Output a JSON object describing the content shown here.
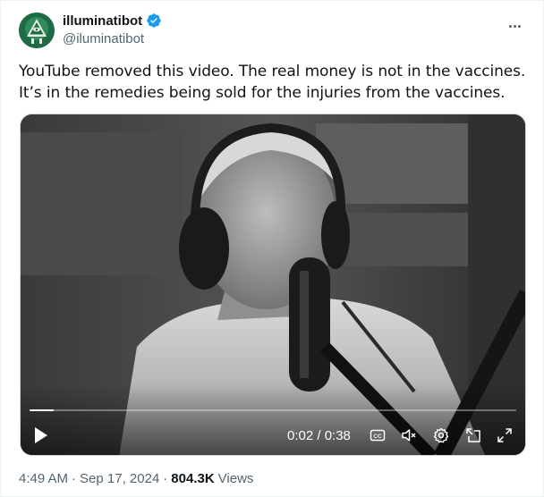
{
  "author": {
    "display_name": "illuminatibot",
    "handle": "@iluminatibot",
    "verified_icon": "verified-badge-icon",
    "avatar_icon": "all-seeing-eye-pyramid-icon"
  },
  "menu": {
    "icon": "more-options-icon"
  },
  "tweet": {
    "text": "YouTube removed this video. The real money is not in the vaccines. It’s in the remedies being sold for the injuries from the vaccines."
  },
  "video": {
    "time_display": "0:02 / 0:38",
    "progress_fraction": 0.05,
    "controls": {
      "play_icon": "play-icon",
      "captions_icon": "cc-icon",
      "mute_icon": "speaker-muted-icon",
      "settings_icon": "gear-icon",
      "pip_icon": "picture-in-picture-icon",
      "fullscreen_icon": "fullscreen-icon"
    }
  },
  "footer": {
    "time": "4:49 AM",
    "date": "Sep 17, 2024",
    "views_count": "804.3K",
    "views_label": "Views"
  },
  "colors": {
    "verified_blue": "#1d9bf0",
    "text_primary": "#0f1419",
    "text_secondary": "#536471",
    "avatar_green": "#1f6b46"
  }
}
